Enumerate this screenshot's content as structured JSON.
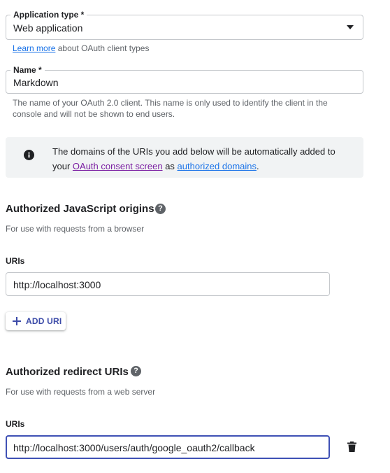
{
  "app_type": {
    "label": "Application type *",
    "value": "Web application",
    "learn_more": "Learn more",
    "learn_more_suffix": "about OAuth client types"
  },
  "name_field": {
    "label": "Name *",
    "value": "Markdown",
    "help_line1": "The name of your OAuth 2.0 client. This name is only used to identify the client in the",
    "help_line2": "console and will not be shown to end users."
  },
  "info": {
    "text_1": "The domains of the URIs you add below will be automatically added to",
    "text_2": "your",
    "link_consent": "OAuth consent screen",
    "text_3": "as",
    "link_domains": "authorized domains",
    "text_4": "."
  },
  "js_origins": {
    "title": "Authorized JavaScript origins",
    "subtitle": "For use with requests from a browser",
    "uris_label": "URIs",
    "uri_value": "http://localhost:3000",
    "add_label": "ADD URI"
  },
  "redirect": {
    "title": "Authorized redirect URIs",
    "subtitle": "For use with requests from a web server",
    "uris_label": "URIs",
    "uri_value": "http://localhost:3000/users/auth/google_oauth2/callback"
  },
  "icons": {
    "info": "info-icon",
    "help": "help-icon",
    "dropdown": "dropdown-arrow-icon",
    "add": "plus-icon",
    "delete": "trash-icon"
  },
  "colors": {
    "link": "#1a73e8",
    "visited_link": "#7b1fa2",
    "focus": "#3f51b5",
    "button_text": "#3c4ba8"
  }
}
